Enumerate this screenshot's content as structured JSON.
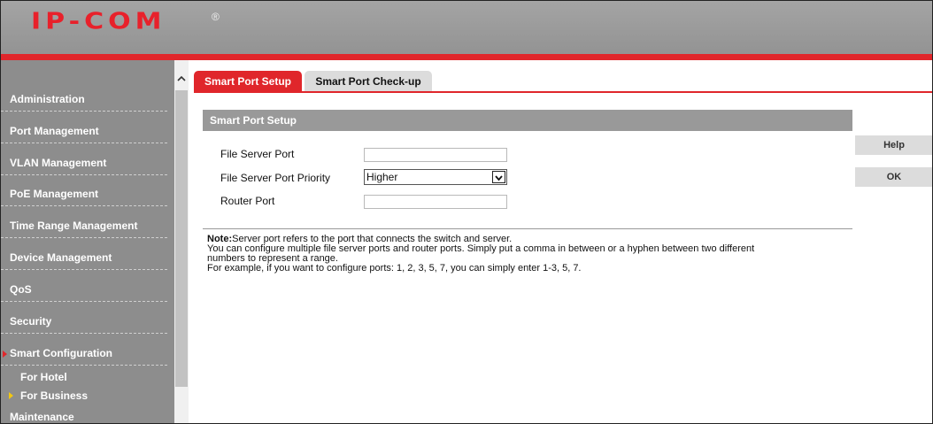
{
  "brand": {
    "logo_text": "IP-COM",
    "registered": "®"
  },
  "sidebar": {
    "items": [
      {
        "label": "Administration"
      },
      {
        "label": "Port Management"
      },
      {
        "label": "VLAN Management"
      },
      {
        "label": "PoE Management"
      },
      {
        "label": "Time Range Management"
      },
      {
        "label": "Device Management"
      },
      {
        "label": "QoS"
      },
      {
        "label": "Security"
      },
      {
        "label": "Smart Configuration",
        "active": true
      },
      {
        "label": "Maintenance"
      }
    ],
    "subitems": [
      {
        "label": "For Hotel"
      },
      {
        "label": "For Business",
        "active": true
      }
    ]
  },
  "tabs": [
    {
      "label": "Smart Port Setup",
      "active": true
    },
    {
      "label": "Smart Port Check-up",
      "active": false
    }
  ],
  "section": {
    "title": "Smart Port Setup"
  },
  "form": {
    "file_server_port": {
      "label": "File Server Port",
      "value": ""
    },
    "priority": {
      "label": "File Server Port Priority",
      "value": "Higher"
    },
    "router_port": {
      "label": "Router Port",
      "value": ""
    }
  },
  "note": {
    "prefix": "Note:",
    "line1": "Server port refers to the port that connects the switch and server.",
    "line2": "You can configure multiple file server ports and router ports. Simply put a comma in between or a hyphen between two different",
    "line3": "numbers to represent a range.",
    "line4": "For example, if you want to configure ports: 1, 2, 3, 5, 7, you can simply enter 1-3, 5, 7."
  },
  "buttons": {
    "help": "Help",
    "ok": "OK"
  },
  "colors": {
    "accent": "#e0262b",
    "sidebar": "#8d8d8d",
    "header": "#9c9c9c",
    "sub_arrow": "#f2c811"
  }
}
